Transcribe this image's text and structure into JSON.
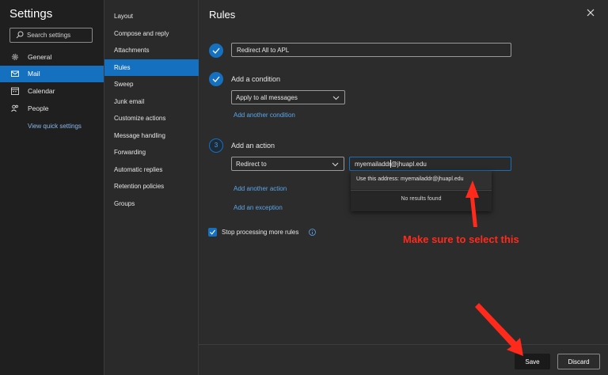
{
  "sidebar": {
    "title": "Settings",
    "search_placeholder": "Search settings",
    "items": [
      {
        "label": "General",
        "icon": "gear-icon"
      },
      {
        "label": "Mail",
        "icon": "mail-icon"
      },
      {
        "label": "Calendar",
        "icon": "calendar-icon"
      },
      {
        "label": "People",
        "icon": "people-icon"
      }
    ],
    "quick_link": "View quick settings"
  },
  "mail_menu": {
    "items": [
      "Layout",
      "Compose and reply",
      "Attachments",
      "Rules",
      "Sweep",
      "Junk email",
      "Customize actions",
      "Message handling",
      "Forwarding",
      "Automatic replies",
      "Retention policies",
      "Groups"
    ],
    "active": "Rules"
  },
  "panel": {
    "title": "Rules",
    "rule_name": "Redirect All to APL",
    "condition": {
      "label": "Add a condition",
      "selected": "Apply to all messages",
      "add_link": "Add another condition"
    },
    "action": {
      "step": "3",
      "label": "Add an action",
      "selected": "Redirect to",
      "email_value": "myemailaddr@jhuapl.edu",
      "suggestion": "Use this address: myemailaddr@jhuapl.edu",
      "no_results": "No results found",
      "add_action_link": "Add another action",
      "add_exception_link": "Add an exception"
    },
    "stop_processing": "Stop processing more rules",
    "annotation": "Make sure to select this",
    "save_label": "Save",
    "discard_label": "Discard"
  },
  "colors": {
    "accent": "#1670c0",
    "annotation": "#ff2a1c"
  }
}
